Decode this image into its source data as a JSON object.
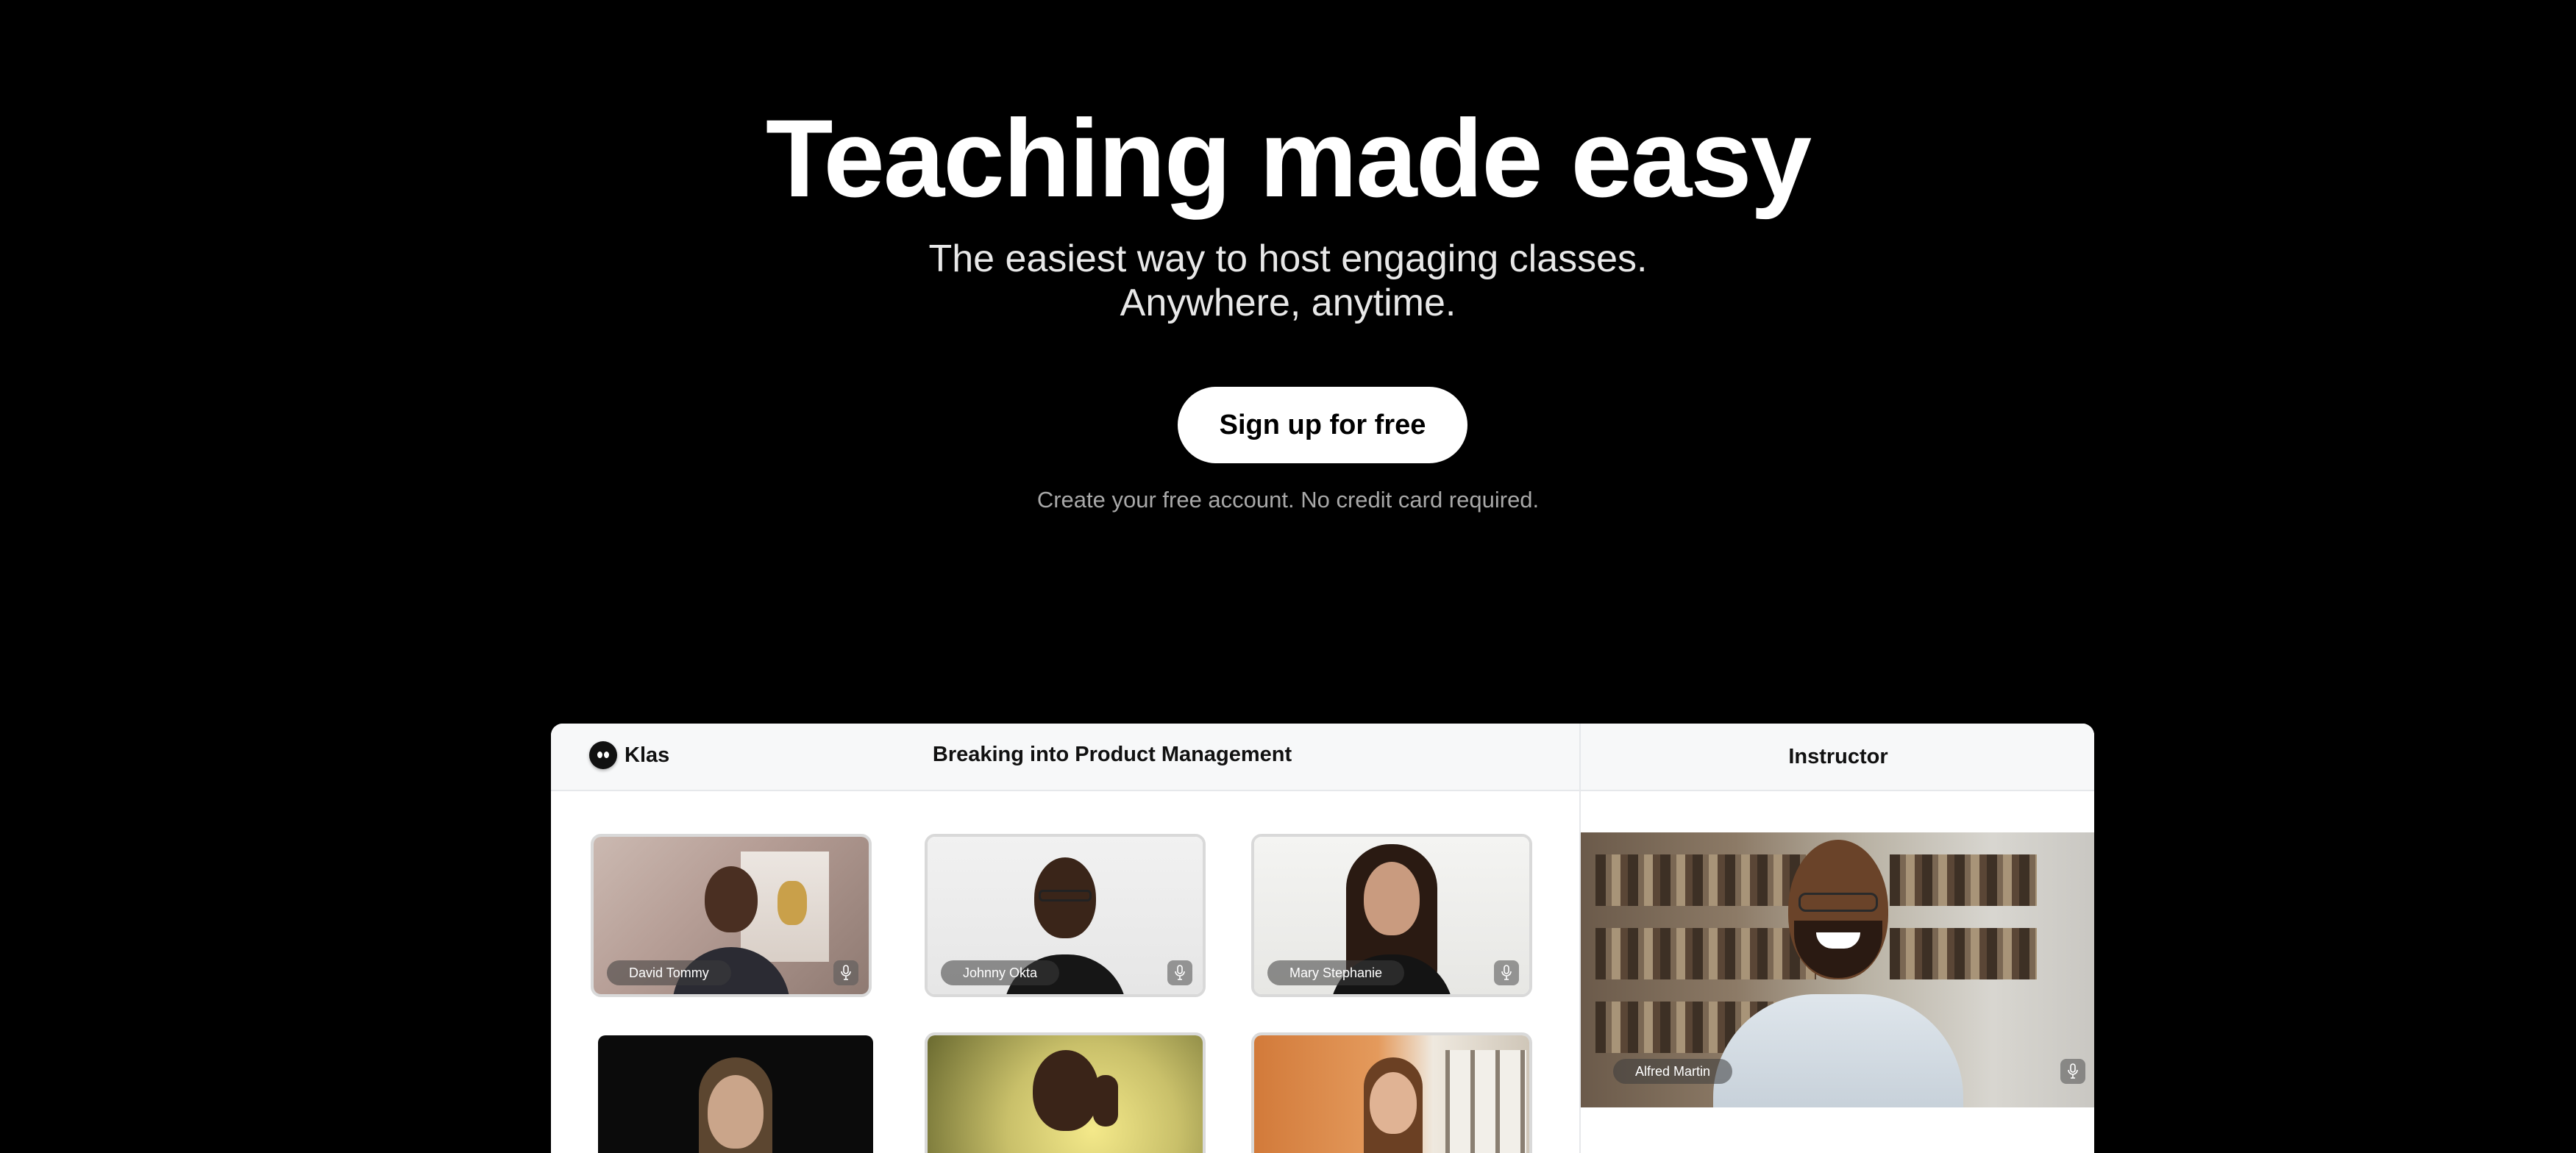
{
  "hero": {
    "title": "Teaching made easy",
    "subtitle_line1": "The easiest way to host engaging classes.",
    "subtitle_line2": "Anywhere, anytime.",
    "cta_label": "Sign up for free",
    "cta_note": "Create your free account. No credit card required."
  },
  "app": {
    "logo_text": "Klas",
    "class_title": "Breaking into Product Management",
    "instructor_header": "Instructor",
    "instructor": {
      "name": "Alfred Martin",
      "icon": "microphone-icon"
    },
    "participants": [
      {
        "name": "David Tommy",
        "icon": "microphone-icon"
      },
      {
        "name": "Johnny Okta",
        "icon": "microphone-icon"
      },
      {
        "name": "Mary Stephanie",
        "icon": "microphone-icon"
      },
      {
        "name": "",
        "icon": ""
      },
      {
        "name": "",
        "icon": ""
      },
      {
        "name": "",
        "icon": ""
      }
    ]
  },
  "colors": {
    "page_background": "#000000",
    "cta_background": "#ffffff",
    "panel_header": "#f7f8f9"
  }
}
